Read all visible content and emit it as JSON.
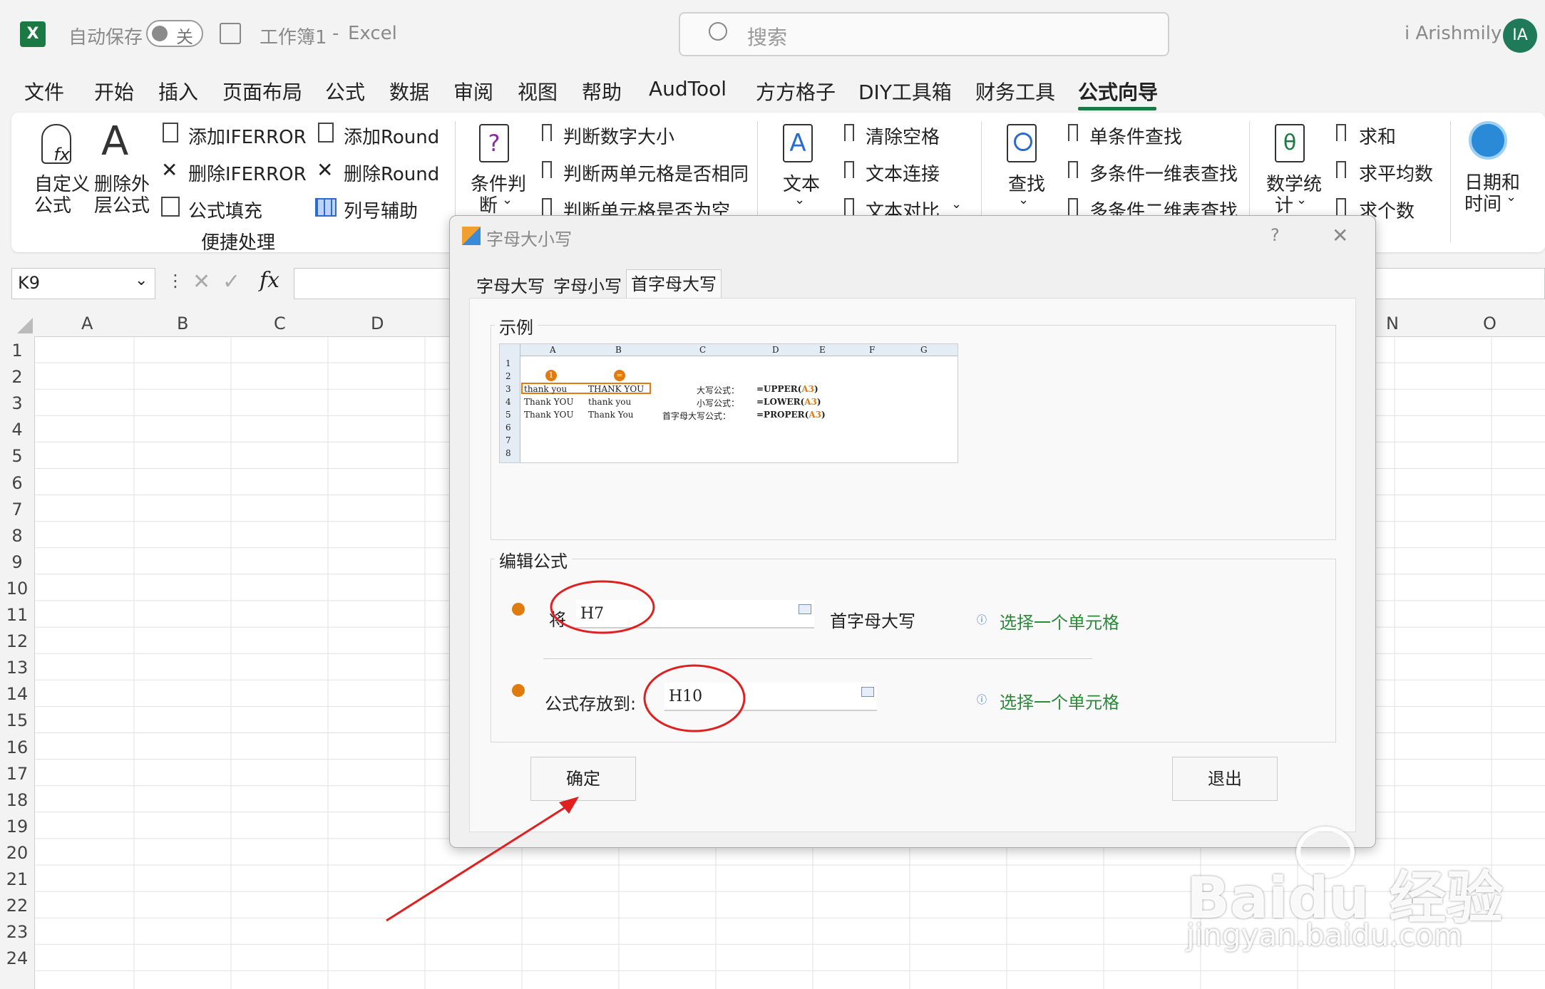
{
  "titlebar": {
    "autosave_label": "自动保存",
    "autosave_state": "关",
    "workbook": "工作簿1",
    "dash": "-",
    "app": "Excel",
    "search_placeholder": "搜索",
    "user_name": "i Arishmily",
    "user_initials": "IA"
  },
  "menu": {
    "tabs": [
      "文件",
      "开始",
      "插入",
      "页面布局",
      "公式",
      "数据",
      "审阅",
      "视图",
      "帮助",
      "AudTool",
      "方方格子",
      "DIY工具箱",
      "财务工具",
      "公式向导"
    ]
  },
  "ribbon": {
    "custom_formula_1": "自定义",
    "custom_formula_2": "公式",
    "delete_outer_1": "删除外",
    "delete_outer_2": "层公式",
    "add_iferror": "添加IFERROR",
    "delete_iferror": "删除IFERROR",
    "formula_fill": "公式填充",
    "add_round": "添加Round",
    "delete_round": "删除Round",
    "col_helper": "列号辅助",
    "group_quick": "便捷处理",
    "cond_1": "条件判",
    "cond_2": "断",
    "judge_num": "判断数字大小",
    "judge_two": "判断两单元格是否相同",
    "judge_empty": "判断单元格是否为空",
    "text": "文本",
    "clear_space": "清除空格",
    "text_concat": "文本连接",
    "text_compare": "文本对比",
    "find": "查找",
    "single_find": "单条件查找",
    "multi_1d": "多条件一维表查找",
    "multi_2d": "多条件二维表查找",
    "math_1": "数学统",
    "math_2": "计",
    "sum": "求和",
    "avg": "求平均数",
    "count": "求个数",
    "datetime_1": "日期和",
    "datetime_2": "时间"
  },
  "formula_bar": {
    "name_box": "K9",
    "fx": "fx"
  },
  "grid": {
    "columns_left": [
      "A",
      "B",
      "C",
      "D"
    ],
    "columns_right": [
      "N",
      "O"
    ],
    "rows": [
      "1",
      "2",
      "3",
      "4",
      "5",
      "6",
      "7",
      "8",
      "9",
      "10",
      "11",
      "12",
      "13",
      "14",
      "15",
      "16",
      "17",
      "18",
      "19",
      "20",
      "21",
      "22",
      "23",
      "24"
    ]
  },
  "dialog": {
    "title": "字母大小写",
    "help": "?",
    "close": "✕",
    "tabs": [
      "字母大写",
      "字母小写",
      "首字母大写"
    ],
    "example_title": "示例",
    "sample": {
      "cols": [
        "A",
        "B",
        "C",
        "D",
        "E",
        "F",
        "G"
      ],
      "rows": [
        "1",
        "2",
        "3",
        "4",
        "5",
        "6",
        "7",
        "8"
      ],
      "a3": "thank you",
      "b3": "THANK YOU",
      "a4": "Thank YOU",
      "b4": "thank you",
      "a5": "Thank YOU",
      "b5": "Thank You",
      "c3": "大写公式：",
      "d3": "=UPPER(",
      "r3": "A3",
      "p3": ")",
      "c4": "小写公式：",
      "d4": "=LOWER(",
      "r4": "A3",
      "p4": ")",
      "c5": "首字母大写公式：",
      "d5": "=PROPER(",
      "r5": "A3",
      "p5": ")",
      "marker1": "1",
      "marker2": "="
    },
    "edit_title": "编辑公式",
    "row1_prefix": "将",
    "row1_value": "H7",
    "row1_suffix": "首字母大写",
    "row1_hint": "选择一个单元格",
    "row2_label": "公式存放到:",
    "row2_value": "H10",
    "row2_hint": "选择一个单元格",
    "ok": "确定",
    "exit": "退出"
  },
  "watermark": {
    "brand": "Bai",
    "brand2": "du",
    "cn": "经验",
    "url": "jingyan.baidu.com"
  },
  "colors": {
    "excel_green": "#1b7a43",
    "annotation_red": "#e02020",
    "hint_green": "#2a8a3a"
  }
}
